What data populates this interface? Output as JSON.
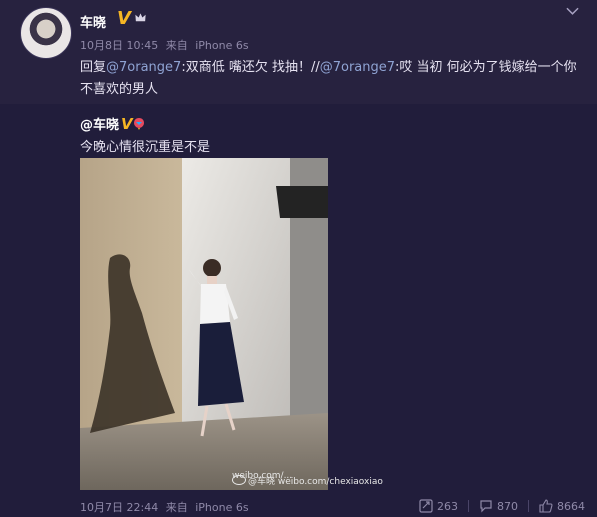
{
  "post": {
    "author": "车晓",
    "verified_mark": "V",
    "timestamp": "10月8日 10:45",
    "source_prefix": "来自",
    "device": "iPhone 6s",
    "text_prefix": "回复",
    "mention1": "@7orange7",
    "text_middle": ":双商低 嘴还欠 找抽！//",
    "mention2": "@7orange7",
    "text_end": ":哎 当初  何必为了钱嫁给一个你不喜欢的男人"
  },
  "repost": {
    "author": "@车晓",
    "verified_mark": "V",
    "text": "今晚心情很沉重是不是",
    "watermark": "@车晓\nweibo.com/chexiaoxiao"
  },
  "footer": {
    "timestamp": "10月7日 22:44",
    "source_prefix": "来自",
    "device": "iPhone 6s",
    "repost_count": "263",
    "comment_count": "870",
    "like_count": "8664"
  },
  "icons": {
    "chevron": "chevron-down-icon",
    "crown": "crown-icon",
    "repost": "repost-icon",
    "comment": "comment-icon",
    "like": "like-icon"
  },
  "colors": {
    "background": "#211d3b",
    "header_background": "#27223f",
    "mention": "#8fa3d3",
    "verified": "#f6b624",
    "meta": "#8f89a8"
  }
}
